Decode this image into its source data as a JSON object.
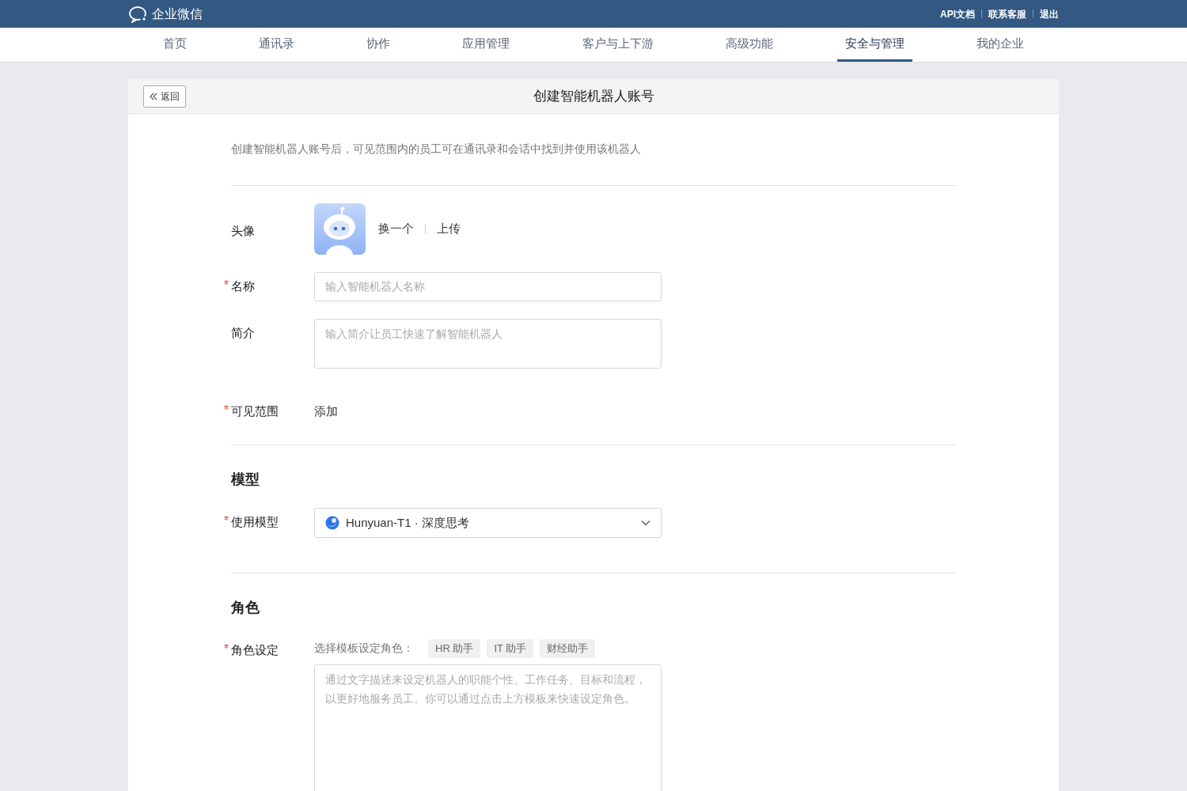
{
  "topbar": {
    "brand": "企业微信",
    "links": [
      "API文档",
      "联系客服",
      "退出"
    ]
  },
  "nav": [
    {
      "label": "首页",
      "selected": false
    },
    {
      "label": "通讯录",
      "selected": false
    },
    {
      "label": "协作",
      "selected": false
    },
    {
      "label": "应用管理",
      "selected": false
    },
    {
      "label": "客户与上下游",
      "selected": false
    },
    {
      "label": "高级功能",
      "selected": false
    },
    {
      "label": "安全与管理",
      "selected": true
    },
    {
      "label": "我的企业",
      "selected": false
    }
  ],
  "page": {
    "back": "返回",
    "title": "创建智能机器人账号",
    "description": "创建智能机器人账号后，可见范围内的员工可在通讯录和会话中找到并使用该机器人"
  },
  "sections": [
    {
      "fields": [
        {
          "kind": "avatar",
          "label": "头像",
          "required": false,
          "actions": [
            "换一个",
            "上传"
          ]
        },
        {
          "kind": "text",
          "label": "名称",
          "required": true,
          "placeholder": "输入智能机器人名称"
        },
        {
          "kind": "textarea",
          "label": "简介",
          "required": false,
          "placeholder": "输入简介让员工快速了解智能机器人"
        },
        {
          "kind": "link",
          "label": "可见范围",
          "required": true,
          "link": "添加"
        }
      ]
    },
    {
      "title": "模型",
      "fields": [
        {
          "kind": "select",
          "label": "使用模型",
          "required": true,
          "value": "Hunyuan-T1 · 深度思考"
        }
      ]
    },
    {
      "title": "角色",
      "fields": [
        {
          "kind": "role",
          "label": "角色设定",
          "required": true,
          "hint": "选择模板设定角色：",
          "templates": [
            "HR 助手",
            "IT 助手",
            "财经助手"
          ],
          "placeholder": "通过文字描述来设定机器人的职能个性、工作任务、目标和流程，以更好地服务员工。你可以通过点击上方模板来快速设定角色。"
        }
      ]
    }
  ]
}
